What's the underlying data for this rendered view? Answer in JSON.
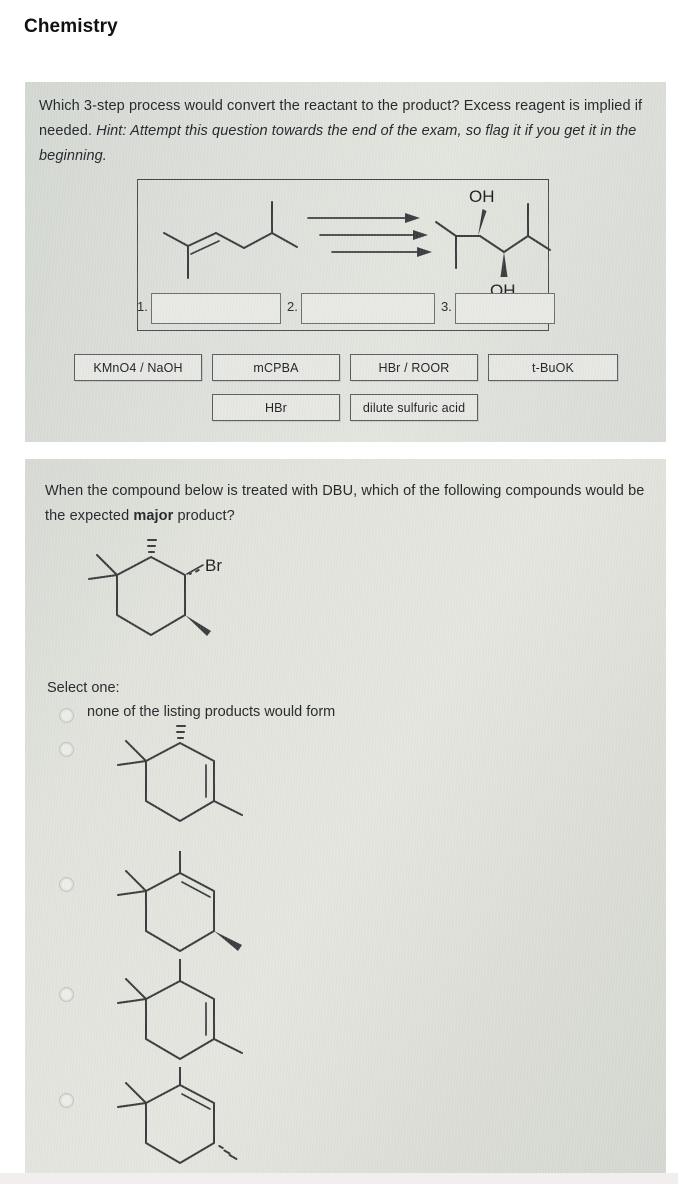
{
  "page": {
    "title": "Chemistry"
  },
  "question1": {
    "prompt_part1": "Which 3-step process would convert the reactant to the product? Excess reagent is implied if needed. ",
    "prompt_hint": "Hint: Attempt this question towards the end of the exam, so flag it if you get it in the beginning.",
    "reactant_name": "2,5-dimethylhex-2-ene",
    "product_name": "2,5-dimethylhexane-3,4-diol",
    "product_labels": [
      "OH",
      "OH"
    ],
    "arrow_count": 3,
    "slots": [
      {
        "number": "1.",
        "value": ""
      },
      {
        "number": "2.",
        "value": ""
      },
      {
        "number": "3.",
        "value": ""
      }
    ],
    "reagents": [
      {
        "label": "KMnO4 / NaOH"
      },
      {
        "label": "mCPBA"
      },
      {
        "label": "HBr / ROOR"
      },
      {
        "label": "t-BuOK"
      },
      {
        "label": "HBr"
      },
      {
        "label": "dilute sulfuric acid"
      }
    ]
  },
  "question2": {
    "prompt_part1": "When the compound below is treated with DBU, which of the following compounds would be the expected ",
    "prompt_bold": "major",
    "prompt_part2": " product?",
    "substrate_label": "Br",
    "substrate_name": "1-bromo-2,5,5-trimethylcyclohexane",
    "select_one_label": "Select one:",
    "options": [
      {
        "id": "opt-a",
        "type": "text",
        "label": "none of the listing products would form",
        "selected": false
      },
      {
        "id": "opt-b",
        "type": "structure",
        "label": "",
        "selected": false
      },
      {
        "id": "opt-c",
        "type": "structure",
        "label": "",
        "selected": false
      },
      {
        "id": "opt-d",
        "type": "structure",
        "label": "",
        "selected": false
      },
      {
        "id": "opt-e",
        "type": "structure",
        "label": "",
        "selected": false
      }
    ]
  },
  "colors": {
    "page_background": "#ffffff",
    "card_background": "#d9dcd6",
    "ink": "#3a3d3f",
    "text": "#23262a",
    "tile_background": "#e7e8e3",
    "tile_border": "#5b5e60"
  }
}
